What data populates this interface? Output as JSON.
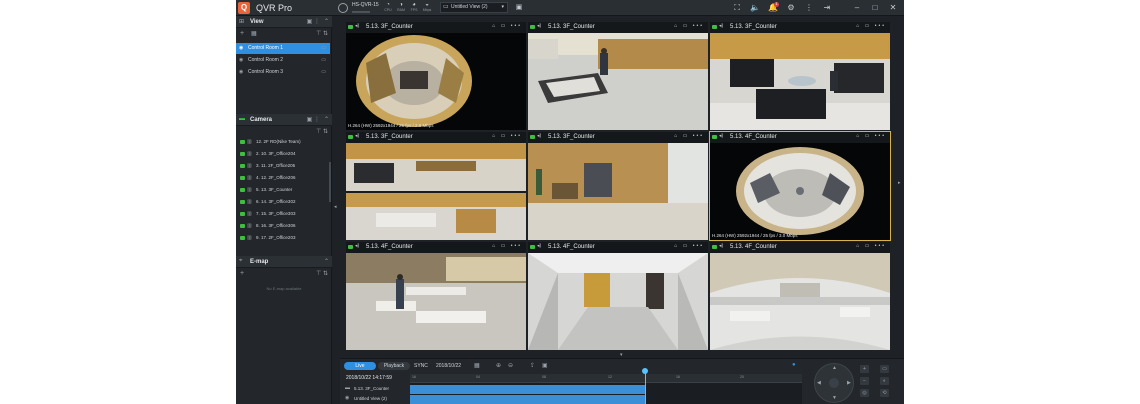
{
  "app": {
    "logo_letter": "Q",
    "name": "QVR Pro",
    "server_name": "HS-QVR-15",
    "server_sub": "xxxxxxxxx"
  },
  "stats": [
    {
      "label": "CPU",
      "glyph": "◔"
    },
    {
      "label": "RAM",
      "glyph": "◑"
    },
    {
      "label": "FPS",
      "glyph": "◕"
    },
    {
      "label": "Mbps",
      "glyph": "◒"
    }
  ],
  "toolbar": {
    "view_selector": "Untitled View (2)",
    "alert_count": "1"
  },
  "view_section": {
    "title": "View",
    "items": [
      {
        "label": "Control Room 1",
        "selected": true
      },
      {
        "label": "Control Room 2",
        "selected": false
      },
      {
        "label": "Control Room 3",
        "selected": false
      }
    ]
  },
  "camera_section": {
    "title": "Camera",
    "items": [
      "12. 2F RD(Nike Team)",
      "2. 10. 3F_Office204",
      "3. 11. 2F_Office205",
      "4. 12. 2F_Office206",
      "5. 13. 3F_Counter",
      "6. 14. 3F_Office302",
      "7. 15. 3F_Office303",
      "8. 16. 3F_Office306",
      "9. 17. 2F_Office203"
    ]
  },
  "emap_section": {
    "title": "E-map",
    "empty_text": "No E-map available"
  },
  "cells": [
    {
      "name": "5.13. 3F_Counter",
      "label": "H.264 (HW) 2592x1944 / 25 fps / 2.8 Mbps",
      "scene": "fisheye-lobby"
    },
    {
      "name": "5.13. 3F_Counter",
      "label": "",
      "scene": "counter"
    },
    {
      "name": "5.13. 3F_Counter",
      "label": "",
      "scene": "sofa"
    },
    {
      "name": "5.13. 3F_Counter",
      "label": "",
      "scene": "split"
    },
    {
      "name": "5.13. 3F_Counter",
      "label": "",
      "scene": "room"
    },
    {
      "name": "5.13. 4F_Counter",
      "label": "H.264 (HW) 2592x1944 / 25 fps / 3.0 Mbps",
      "scene": "fisheye-office"
    },
    {
      "name": "5.13. 4F_Counter",
      "label": "",
      "scene": "tables"
    },
    {
      "name": "5.13. 4F_Counter",
      "label": "",
      "scene": "hall"
    },
    {
      "name": "5.13. 4F_Counter",
      "label": "",
      "scene": "panorama"
    }
  ],
  "timeline": {
    "live_tab": "Live",
    "playback_tab": "Playback",
    "sync_label": "SYNC",
    "date": "2018/10/22",
    "current_time": "2018/10/22 14:17:59",
    "rows": [
      "5.13. 3F_Counter",
      "Untitled View (2)"
    ],
    "ticks": [
      "16",
      "04",
      "08",
      "12",
      "16",
      "20"
    ],
    "position_fraction": 0.6
  },
  "colors": {
    "accent": "#2f8fe0",
    "brand": "#e8643a",
    "active_border": "#d6b34a",
    "online": "#3fbf3f"
  }
}
